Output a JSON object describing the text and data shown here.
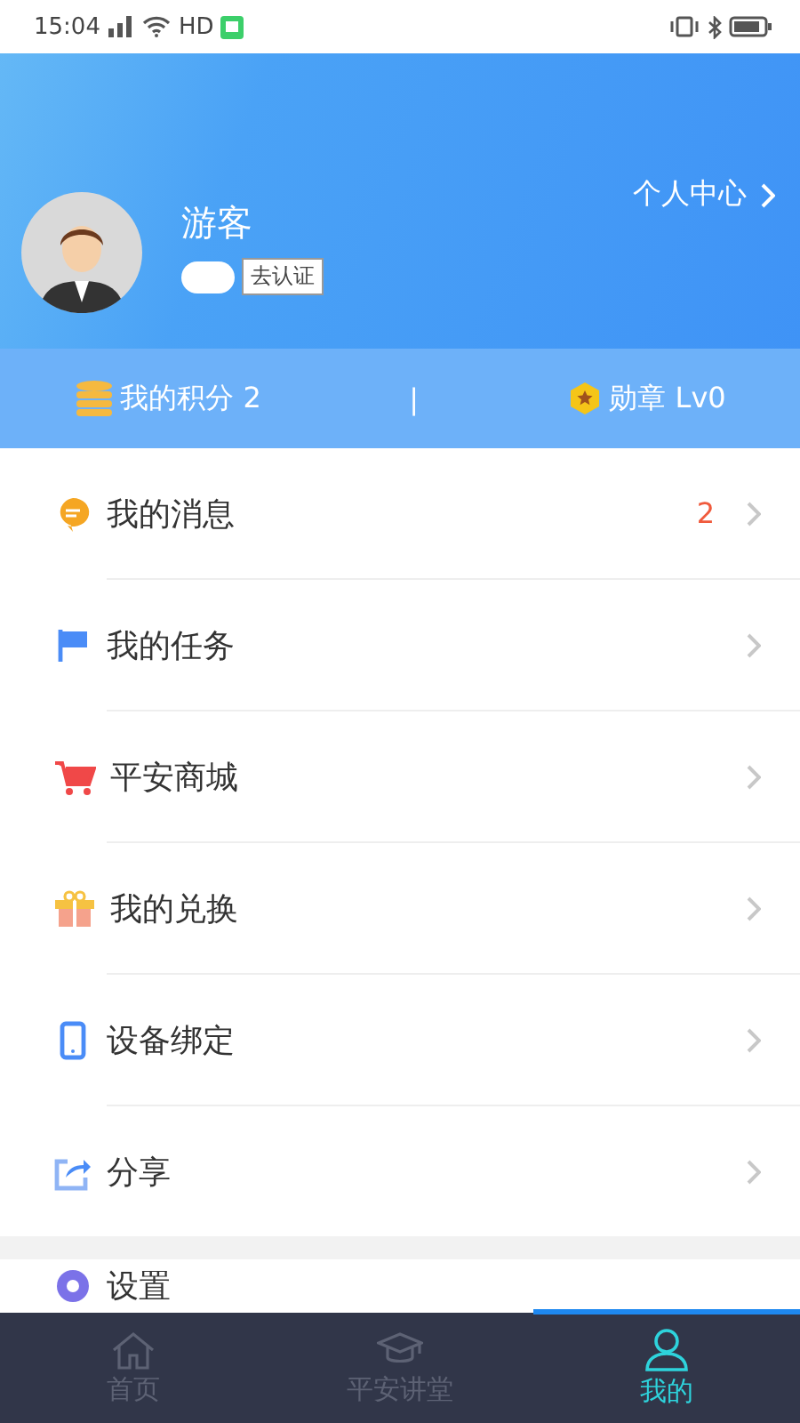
{
  "status_bar": {
    "time": "15:04",
    "network": "HD"
  },
  "profile": {
    "name": "游客",
    "verify_button": "去认证",
    "center_link": "个人中心"
  },
  "stats": {
    "points": "我的积分 2",
    "separator": "|",
    "medal": "勋章 Lv0"
  },
  "menu": [
    {
      "label": "我的消息",
      "badge": "2"
    },
    {
      "label": "我的任务"
    },
    {
      "label": "平安商城"
    },
    {
      "label": "我的兑换"
    },
    {
      "label": "设备绑定"
    },
    {
      "label": "分享"
    }
  ],
  "settings_row": {
    "label": "设置"
  },
  "tabs": [
    {
      "label": "首页",
      "selected": false
    },
    {
      "label": "平安讲堂",
      "selected": false
    },
    {
      "label": "我的",
      "selected": true
    }
  ]
}
